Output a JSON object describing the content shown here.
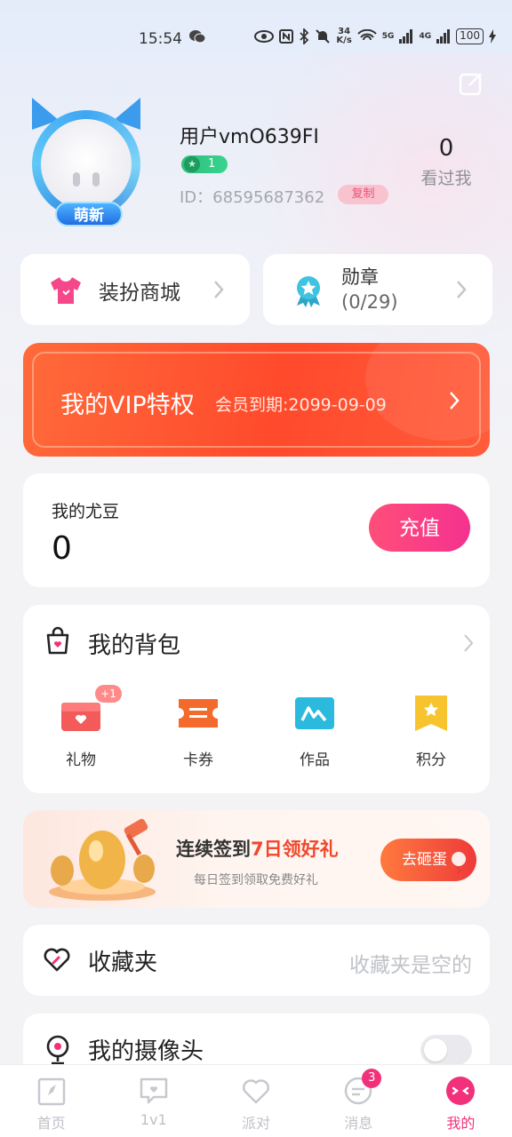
{
  "status_bar": {
    "time": "15:54",
    "net_speed_value": "34",
    "net_speed_unit": "K/s",
    "signal_5g": "5G",
    "signal_4g": "4G",
    "battery": "100"
  },
  "profile": {
    "username": "用户vmO639FI",
    "level": "1",
    "id_label": "ID：",
    "id_value": "68595687362",
    "copy_label": "复制",
    "avatar_badge": "萌新",
    "visits_count": "0",
    "visits_label": "看过我"
  },
  "quick_cards": {
    "dressup_label": "装扮商城",
    "medal_label": "勋章",
    "medal_progress": "(0/29)"
  },
  "vip": {
    "title": "我的VIP特权",
    "expire": "会员到期:2099-09-09"
  },
  "coins": {
    "label": "我的尤豆",
    "value": "0",
    "recharge_label": "充值"
  },
  "backpack": {
    "title": "我的背包",
    "items": [
      {
        "label": "礼物",
        "badge": "+1"
      },
      {
        "label": "卡券"
      },
      {
        "label": "作品"
      },
      {
        "label": "积分"
      }
    ]
  },
  "signin": {
    "title_prefix": "连续签到",
    "title_highlight": "7日领好礼",
    "subtitle": "每日签到领取免费好礼",
    "button_label": "去砸蛋"
  },
  "favorites": {
    "title": "收藏夹",
    "empty_text": "收藏夹是空的"
  },
  "camera": {
    "title": "我的摄像头",
    "enabled": false
  },
  "tabbar": {
    "tabs": [
      {
        "label": "首页",
        "active": false
      },
      {
        "label": "1v1",
        "active": false
      },
      {
        "label": "派对",
        "active": false
      },
      {
        "label": "消息",
        "active": false,
        "badge": "3"
      },
      {
        "label": "我的",
        "active": true
      }
    ]
  },
  "colors": {
    "accent_pink": "#f2317a",
    "vip_orange": "#ff4a2c",
    "level_green": "#2fbf7a",
    "avatar_blue": "#3b9bec"
  }
}
